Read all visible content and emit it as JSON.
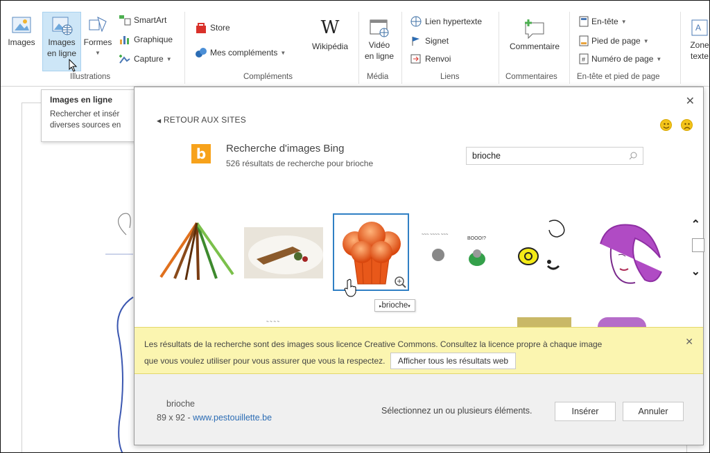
{
  "ribbon": {
    "groups": {
      "illustrations": {
        "label": "Illustrations",
        "images": "Images",
        "online_images_line1": "Images",
        "online_images_line2": "en ligne",
        "shapes": "Formes",
        "smartart": "SmartArt",
        "chart": "Graphique",
        "screenshot": "Capture"
      },
      "addins": {
        "label": "Compléments",
        "store": "Store",
        "my_addins": "Mes compléments",
        "wikipedia": "Wikipédia"
      },
      "media": {
        "label": "Média",
        "video_line1": "Vidéo",
        "video_line2": "en ligne"
      },
      "links": {
        "label": "Liens",
        "hyperlink": "Lien hypertexte",
        "bookmark": "Signet",
        "crossref": "Renvoi"
      },
      "comments": {
        "label": "Commentaires",
        "comment": "Commentaire"
      },
      "header_footer": {
        "label": "En-tête et pied de page",
        "header": "En-tête",
        "footer": "Pied de page",
        "page_number": "Numéro de page"
      },
      "text": {
        "textbox_line1": "Zone",
        "textbox_line2": "texte"
      }
    }
  },
  "tooltip": {
    "title": "Images en ligne",
    "body_line1": "Rechercher et insér",
    "body_line2": "diverses sources en"
  },
  "dialog": {
    "back": "RETOUR AUX SITES",
    "close": "✕",
    "bing_title": "Recherche d'images Bing",
    "results": "526 résultats de recherche pour brioche",
    "search_value": "brioche",
    "hover_label": "brioche",
    "banner": {
      "line1": "Les résultats de la recherche sont des images sous licence Creative Commons. Consultez la licence propre à chaque image",
      "line2": "que vous voulez utiliser pour vous assurer que vous la respectez.",
      "button": "Afficher tous les résultats web",
      "close": "✕"
    },
    "footer": {
      "name": "brioche",
      "dims": "89 x 92 - ",
      "link": "www.pestouillette.be",
      "hint": "Sélectionnez un ou plusieurs éléments.",
      "insert": "Insérer",
      "cancel": "Annuler"
    }
  },
  "colors": {
    "selection": "#2f7fc4",
    "bing": "#f7a21b",
    "banner": "#fbf5b0",
    "link": "#2b6cb4"
  }
}
